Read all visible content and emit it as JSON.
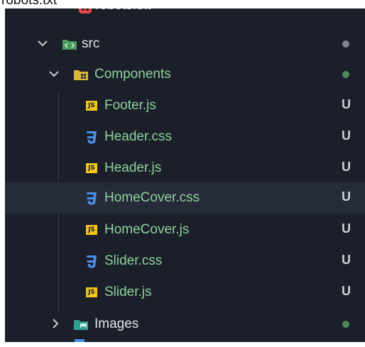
{
  "partial_item": {
    "label": "robots.txt"
  },
  "tree": {
    "src": {
      "label": "src"
    },
    "components": {
      "label": "Components"
    },
    "files": [
      {
        "label": "Footer.js",
        "status": "U",
        "type": "js"
      },
      {
        "label": "Header.css",
        "status": "U",
        "type": "css"
      },
      {
        "label": "Header.js",
        "status": "U",
        "type": "js"
      },
      {
        "label": "HomeCover.css",
        "status": "U",
        "type": "css"
      },
      {
        "label": "HomeCover.js",
        "status": "U",
        "type": "js"
      },
      {
        "label": "Slider.css",
        "status": "U",
        "type": "css"
      },
      {
        "label": "Slider.js",
        "status": "U",
        "type": "js"
      }
    ],
    "images": {
      "label": "Images"
    },
    "js_badge": "JS"
  },
  "colors": {
    "panel_bg": "#1b1f2a",
    "selected_bg": "#262b39",
    "folder_label": "#dfe3ea",
    "untracked_label": "#8ed09a",
    "modified_dot": "#7f848e",
    "untracked_dot": "#4f8a5b",
    "css_blue": "#4a8fe8",
    "js_yellow": "#f5c518"
  }
}
